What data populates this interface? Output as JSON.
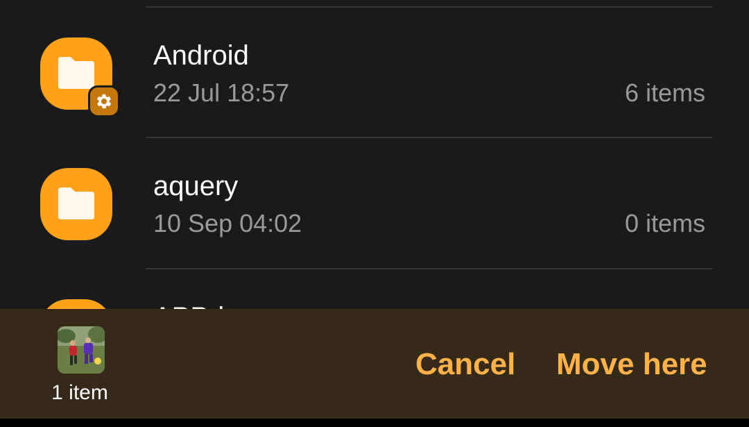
{
  "folders": [
    {
      "name": "Android",
      "date": "22 Jul 18:57",
      "count": "6 items",
      "badge_icon": "gear-icon"
    },
    {
      "name": "aquery",
      "date": "10 Sep 04:02",
      "count": "0 items"
    },
    {
      "name": "APPd..."
    }
  ],
  "bottom_bar": {
    "selected_count": "1 item",
    "thumbnail_icon": "soccer-photo-thumbnail",
    "cancel_label": "Cancel",
    "move_label": "Move here"
  },
  "colors": {
    "background": "#1a1a1a",
    "folder": "#ffa21a",
    "bottom_bar": "#35291a",
    "accent_text": "#ffb24a"
  }
}
